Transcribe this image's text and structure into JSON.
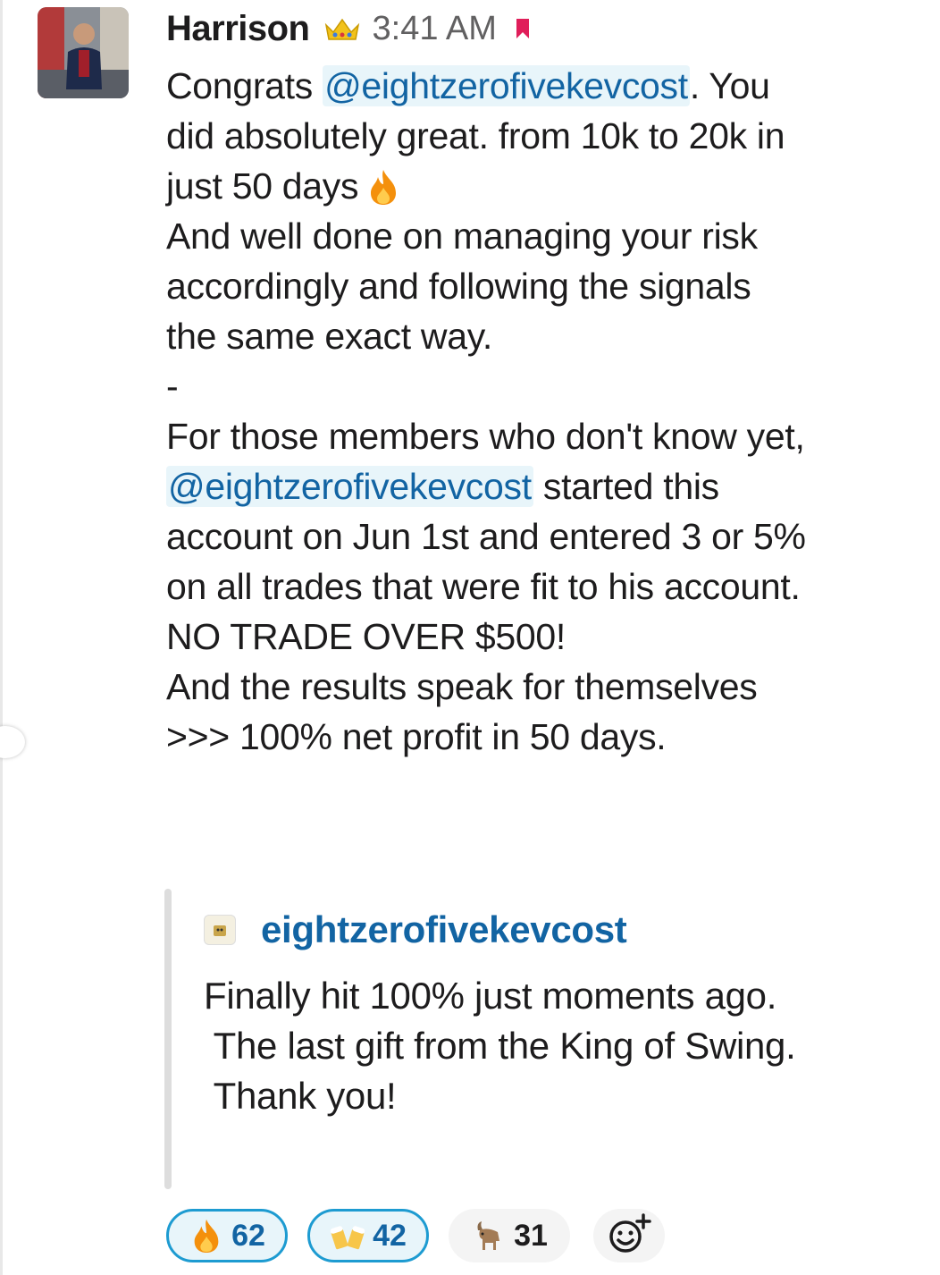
{
  "message": {
    "sender": "Harrison",
    "time": "3:41 AM",
    "lines": [
      [
        "Congrats ",
        "@eightzerofivekevcost",
        ". You"
      ],
      [
        "did absolutely great. from 10k to 20k in"
      ],
      [
        "just 50 days"
      ],
      [
        "And well done on managing your risk"
      ],
      [
        "accordingly and following the signals"
      ],
      [
        "the same exact way."
      ],
      [
        "-"
      ],
      [
        "For those members who don't know yet,"
      ],
      [
        "@eightzerofivekevcost",
        " started this"
      ],
      [
        "account on Jun 1st and entered 3 or 5%"
      ],
      [
        "on all trades that were fit to his account."
      ],
      [
        "NO TRADE OVER $500!"
      ],
      [
        "And the results speak for themselves"
      ],
      [
        ">>> 100% net profit in 50 days."
      ]
    ]
  },
  "quote": {
    "author": "eightzerofivekevcost",
    "lines": [
      "Finally hit 100% just moments ago.",
      " The last gift from the King of Swing.",
      " Thank you!"
    ]
  },
  "reactions": [
    {
      "emoji": "fire",
      "count": "62",
      "active": true
    },
    {
      "emoji": "beer-mugs",
      "count": "42",
      "active": true
    },
    {
      "emoji": "goat",
      "count": "31",
      "active": false
    }
  ],
  "colors": {
    "mention": "#1264a3",
    "mention_bg": "#e8f5fa",
    "reaction_border": "#1d9bd1",
    "bookmark": "#e01e5a"
  }
}
